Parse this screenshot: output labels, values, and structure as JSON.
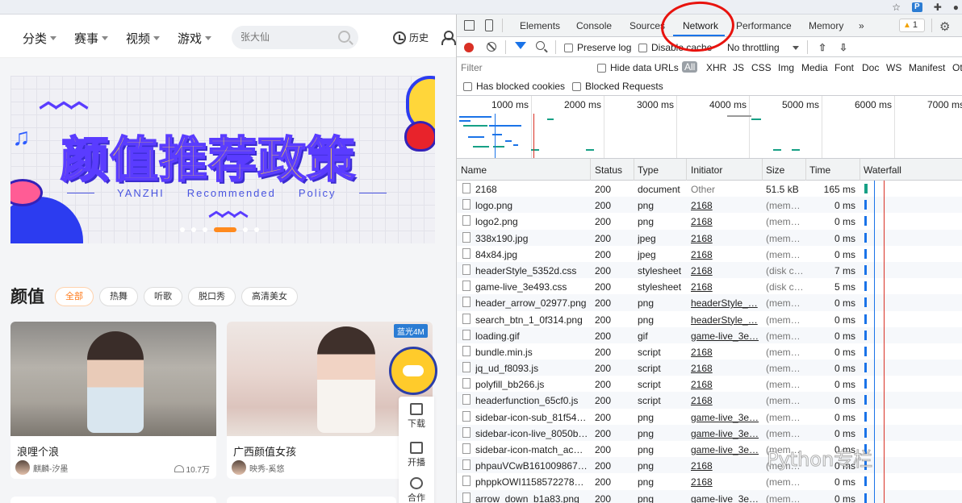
{
  "browser": {
    "extension_badge": "P"
  },
  "site": {
    "nav": [
      "分类",
      "赛事",
      "视频",
      "游戏"
    ],
    "search_placeholder": "张大仙",
    "history_label": "历史",
    "banner": {
      "title": "颜值推荐政策",
      "subtitle_words": [
        "YANZHI",
        "Recommended",
        "Policy"
      ]
    },
    "section_title": "颜值",
    "tags": [
      "全部",
      "热舞",
      "听歌",
      "脱口秀",
      "高清美女"
    ],
    "cards": [
      {
        "title": "浪哩个浪",
        "anchor": "麒麟-汐墨",
        "viewers": "10.7万"
      },
      {
        "title": "广西颜值女孩",
        "anchor": "映秀-奚悠",
        "viewers": ""
      }
    ],
    "badge": "蓝光4M",
    "sidebar": [
      "下载",
      "开播",
      "合作"
    ]
  },
  "devtools": {
    "tabs": [
      "Elements",
      "Console",
      "Sources",
      "Network",
      "Performance",
      "Memory"
    ],
    "more_tabs": "»",
    "active_tab": "Network",
    "warnings": "1",
    "toolbar": {
      "preserve_log": "Preserve log",
      "disable_cache": "Disable cache",
      "throttling": "No throttling"
    },
    "filter": {
      "placeholder": "Filter",
      "hide_data_urls": "Hide data URLs",
      "types": [
        "All",
        "XHR",
        "JS",
        "CSS",
        "Img",
        "Media",
        "Font",
        "Doc",
        "WS",
        "Manifest",
        "Ot"
      ],
      "blocked_cookies": "Has blocked cookies",
      "blocked_requests": "Blocked Requests"
    },
    "timeline_ticks": [
      "1000 ms",
      "2000 ms",
      "3000 ms",
      "4000 ms",
      "5000 ms",
      "6000 ms",
      "7000 ms"
    ],
    "columns": [
      "Name",
      "Status",
      "Type",
      "Initiator",
      "Size",
      "Time",
      "Waterfall"
    ],
    "requests": [
      {
        "name": "2168",
        "status": "200",
        "type": "document",
        "initiator": "Other",
        "size": "51.5 kB",
        "time": "165 ms"
      },
      {
        "name": "logo.png",
        "status": "200",
        "type": "png",
        "initiator": "2168",
        "size": "(mem…",
        "time": "0 ms"
      },
      {
        "name": "logo2.png",
        "status": "200",
        "type": "png",
        "initiator": "2168",
        "size": "(mem…",
        "time": "0 ms"
      },
      {
        "name": "338x190.jpg",
        "status": "200",
        "type": "jpeg",
        "initiator": "2168",
        "size": "(mem…",
        "time": "0 ms"
      },
      {
        "name": "84x84.jpg",
        "status": "200",
        "type": "jpeg",
        "initiator": "2168",
        "size": "(mem…",
        "time": "0 ms"
      },
      {
        "name": "headerStyle_5352d.css",
        "status": "200",
        "type": "stylesheet",
        "initiator": "2168",
        "size": "(disk c…",
        "time": "7 ms"
      },
      {
        "name": "game-live_3e493.css",
        "status": "200",
        "type": "stylesheet",
        "initiator": "2168",
        "size": "(disk c…",
        "time": "5 ms"
      },
      {
        "name": "header_arrow_02977.png",
        "status": "200",
        "type": "png",
        "initiator": "headerStyle_…",
        "size": "(mem…",
        "time": "0 ms"
      },
      {
        "name": "search_btn_1_0f314.png",
        "status": "200",
        "type": "png",
        "initiator": "headerStyle_…",
        "size": "(mem…",
        "time": "0 ms"
      },
      {
        "name": "loading.gif",
        "status": "200",
        "type": "gif",
        "initiator": "game-live_3e…",
        "size": "(mem…",
        "time": "0 ms"
      },
      {
        "name": "bundle.min.js",
        "status": "200",
        "type": "script",
        "initiator": "2168",
        "size": "(mem…",
        "time": "0 ms"
      },
      {
        "name": "jq_ud_f8093.js",
        "status": "200",
        "type": "script",
        "initiator": "2168",
        "size": "(mem…",
        "time": "0 ms"
      },
      {
        "name": "polyfill_bb266.js",
        "status": "200",
        "type": "script",
        "initiator": "2168",
        "size": "(mem…",
        "time": "0 ms"
      },
      {
        "name": "headerfunction_65cf0.js",
        "status": "200",
        "type": "script",
        "initiator": "2168",
        "size": "(mem…",
        "time": "0 ms"
      },
      {
        "name": "sidebar-icon-sub_81f54.…",
        "status": "200",
        "type": "png",
        "initiator": "game-live_3e…",
        "size": "(mem…",
        "time": "0 ms"
      },
      {
        "name": "sidebar-icon-live_8050b…",
        "status": "200",
        "type": "png",
        "initiator": "game-live_3e…",
        "size": "(mem…",
        "time": "0 ms"
      },
      {
        "name": "sidebar-icon-match_ac6…",
        "status": "200",
        "type": "png",
        "initiator": "game-live_3e…",
        "size": "(mem…",
        "time": "0 ms"
      },
      {
        "name": "phpauVCwB161009867…",
        "status": "200",
        "type": "png",
        "initiator": "2168",
        "size": "(mem…",
        "time": "0 ms"
      },
      {
        "name": "phppkOWI11585722786…",
        "status": "200",
        "type": "png",
        "initiator": "2168",
        "size": "(mem…",
        "time": "0 ms"
      },
      {
        "name": "arrow_down_b1a83.png",
        "status": "200",
        "type": "png",
        "initiator": "game-live_3e…",
        "size": "(mem…",
        "time": "0 ms"
      }
    ]
  },
  "watermark": "Python专栏",
  "colors": {
    "accent": "#1a73e8",
    "record": "#d93025",
    "annotation": "#e8130e",
    "tag_active": "#ff7a1a"
  }
}
